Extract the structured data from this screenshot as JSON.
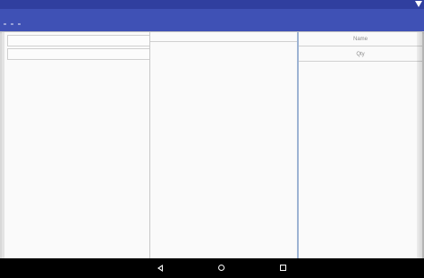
{
  "right_panel": {
    "name_label": "Name",
    "qty_label": "Qty"
  },
  "colors": {
    "status_bar": "#303f9f",
    "app_bar": "#3f51b5",
    "content_bg": "#fafafa",
    "nav_bar": "#000000"
  },
  "icons": {
    "status": "signal-icon",
    "nav_back": "back-icon",
    "nav_home": "home-icon",
    "nav_recents": "recents-icon"
  }
}
